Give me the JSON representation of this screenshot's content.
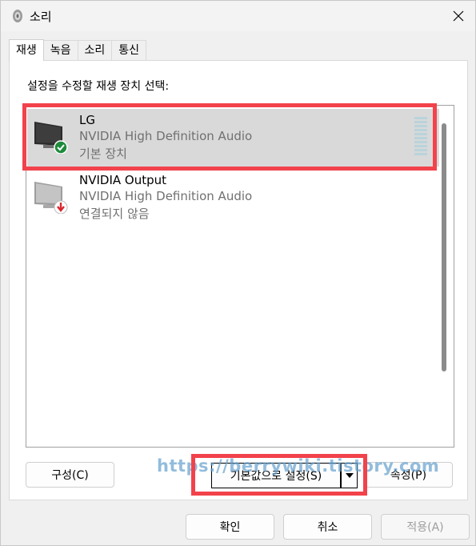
{
  "window": {
    "title": "소리"
  },
  "tabs": [
    {
      "label": "재생",
      "active": true
    },
    {
      "label": "녹음"
    },
    {
      "label": "소리"
    },
    {
      "label": "통신"
    }
  ],
  "instruction": "설정을 수정할 재생 장치 선택:",
  "devices": [
    {
      "name": "LG",
      "driver": "NVIDIA High Definition Audio",
      "status": "기본 장치",
      "selected": true,
      "status_icon": "check-icon"
    },
    {
      "name": "NVIDIA Output",
      "driver": "NVIDIA High Definition Audio",
      "status": "연결되지 않음",
      "selected": false,
      "status_icon": "down-arrow-icon"
    }
  ],
  "buttons": {
    "configure": "구성(C)",
    "set_default": "기본값으로 설정(S)",
    "properties": "속성(P)",
    "ok": "확인",
    "cancel": "취소",
    "apply": "적용(A)"
  },
  "watermark": "https://berrywiki.tistory.com",
  "colors": {
    "highlight_box": "#f2424b",
    "check_green": "#1e8a3c",
    "arrow_red": "#d9262e"
  }
}
